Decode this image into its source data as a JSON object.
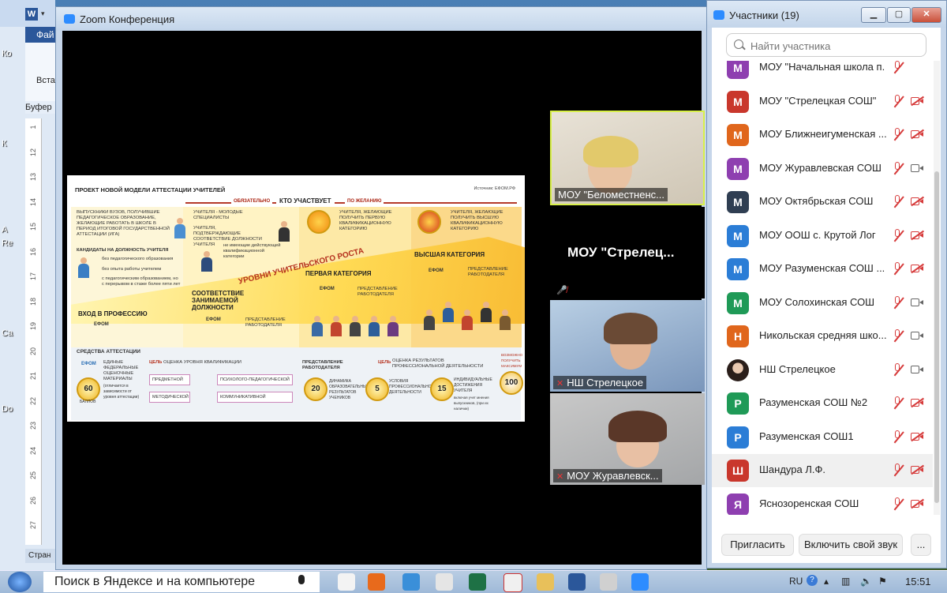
{
  "word": {
    "tab": "Фай",
    "paste": "Вста",
    "buffer": "Буфер",
    "status": "Стран",
    "ruler": [
      "1",
      "12",
      "13",
      "14",
      "15",
      "16",
      "17",
      "18",
      "19",
      "20",
      "21",
      "22",
      "23",
      "24",
      "25",
      "26",
      "27"
    ]
  },
  "desktop_labels": [
    "Ко",
    "К",
    "A",
    "Re",
    "Ca",
    "Do"
  ],
  "zoom": {
    "title": "Zoom Конференция"
  },
  "slide": {
    "header": "ПРОЕКТ НОВОЙ МОДЕЛИ АТТЕСТАЦИИ УЧИТЕЛЕЙ",
    "source": "Источник: ЕФОМ.РФ",
    "obligatory": "ОБЯЗАТЕЛЬНО",
    "who": "КТО УЧАСТВУЕТ",
    "wish": "ПО ЖЕЛАНИЮ",
    "growth": "УРОВНИ УЧИТЕЛЬСКОГО РОСТА",
    "col1_text": "ВЫПУСКНИКИ ВУЗОВ, ПОЛУЧИВШИЕ ПЕДАГОГИЧЕСКОЕ ОБРАЗОВАНИЕ, ЖЕЛАЮЩИЕ РАБОТАТЬ В ШКОЛЕ В ПЕРИОД ИТОГОВОЙ ГОСУДАРСТВЕННОЙ АТТЕСТАЦИИ (ИГА)",
    "col1_cand": "КАНДИДАТЫ НА ДОЛЖНОСТЬ УЧИТЕЛЯ",
    "col1_a": "без педагогического образования",
    "col1_b": "без опыта работы учителем",
    "col1_c": "с педагогическим образованием, но с перерывом в стаже более пяти лет",
    "col2_text": "УЧИТЕЛЯ - МОЛОДЫЕ СПЕЦИАЛИСТЫ",
    "col2_text2": "УЧИТЕЛЯ, ПОДТВЕРЖДАЮЩИЕ СООТВЕТСТВИЕ ДОЛЖНОСТИ УЧИТЕЛЯ",
    "col2_text3": "не имеющие действующей квалификационной категории",
    "col3_text": "УЧИТЕЛЯ, ЖЕЛАЮЩИЕ ПОЛУЧИТЬ ПЕРВУЮ КВАЛИФИКАЦИОННУЮ КАТЕГОРИЮ",
    "col4_text": "УЧИТЕЛЯ, ЖЕЛАЮЩИЕ ПОЛУЧИТЬ ВЫСШУЮ КВАЛИФИКАЦИОННУЮ КАТЕГОРИЮ",
    "lvl1": "ВХОД В ПРОФЕССИЮ",
    "lvl2": "СООТВЕТСТВИЕ ЗАНИМАЕМОЙ ДОЛЖНОСТИ",
    "lvl3": "ПЕРВАЯ КАТЕГОРИЯ",
    "lvl4": "ВЫСШАЯ КАТЕГОРИЯ",
    "efom": "ЕФОМ",
    "employer": "ПРЕДСТАВЛЕНИЕ РАБОТОДАТЕЛЯ",
    "means": "СРЕДСТВА АТТЕСТАЦИИ",
    "efom_full": "ЕДИНЫЕ ФЕДЕРАЛЬНЫЕ ОЦЕНОЧНЫЕ МАТЕРИАЛЫ",
    "efom_note": "(отличается в зависимости от уровня аттестации)",
    "goal": "ЦЕЛЬ",
    "goal1": "ОЦЕНКА УРОВНЯ КВАЛИФИКАЦИИ",
    "goal2": "ОЦЕНКА РЕЗУЛЬТАТОВ ПРОФЕССИОНАЛЬНОЙ ДЕЯТЕЛЬНОСТИ",
    "pills": [
      "ПРЕДМЕТНОЙ",
      "ПСИХОЛОГО-ПЕДАГОГИЧЕСКОЙ",
      "МЕТОДИЧЕСКОЙ",
      "КОММУНИКАТИВНОЙ"
    ],
    "m60": "60",
    "m20": "20",
    "m5": "5",
    "m15": "15",
    "m100": "100",
    "balls": "БАЛЛОВ",
    "d20": "ДИНАМИКА ОБРАЗОВАТЕЛЬНЫХ РЕЗУЛЬТАТОВ УЧЕНИКОВ",
    "d5": "УСЛОВИЯ ПРОФЕССИОНАЛЬНОЙ ДЕЯТЕЛЬНОСТИ",
    "d15": "ИНДИВИДУАЛЬНЫЕ ДОСТИЖЕНИЯ УЧИТЕЛЯ",
    "d15b": "включая учет мнения выпускников, (при их наличии)",
    "max": "ВОЗМОЖНО ПОЛУЧИТЬ МАКСИМУМ"
  },
  "tiles": [
    {
      "label": "МОУ \"Беломестненс...",
      "muted": false
    },
    {
      "center": "МОУ \"Стрелец...",
      "muted": true
    },
    {
      "label": "НШ Стрелецкое",
      "muted": true
    },
    {
      "label": "МОУ Журавлевск...",
      "muted": true
    }
  ],
  "participants": {
    "title": "Участники (19)",
    "search_placeholder": "Найти участника",
    "invite": "Пригласить",
    "unmute": "Включить свой звук",
    "more": "...",
    "list": [
      {
        "initial": "М",
        "name": "МОУ \"Начальная школа п. Ду...",
        "color": "#8e3fb0",
        "cam": "none"
      },
      {
        "initial": "М",
        "name": "МОУ \"Стрелецкая СОШ\"",
        "color": "#c9372c",
        "cam": "off"
      },
      {
        "initial": "М",
        "name": "МОУ Ближнеигуменская ...",
        "color": "#e0661c",
        "cam": "off"
      },
      {
        "initial": "М",
        "name": "МОУ Журавлевская СОШ",
        "color": "#8e3fb0",
        "cam": "on"
      },
      {
        "initial": "М",
        "name": "МОУ Октябрьская СОШ",
        "color": "#2f3e52",
        "cam": "off"
      },
      {
        "initial": "М",
        "name": "МОУ ООШ с. Крутой Лог",
        "color": "#2b7dd6",
        "cam": "off"
      },
      {
        "initial": "М",
        "name": "МОУ Разуменская СОШ ...",
        "color": "#2b7dd6",
        "cam": "off"
      },
      {
        "initial": "М",
        "name": "МОУ Солохинская СОШ",
        "color": "#1f9a57",
        "cam": "on"
      },
      {
        "initial": "Н",
        "name": "Никольская средняя шко...",
        "color": "#e0661c",
        "cam": "on"
      },
      {
        "initial": "",
        "name": "НШ Стрелецкое",
        "color": "#6b5a55",
        "cam": "on"
      },
      {
        "initial": "Р",
        "name": "Разуменская СОШ №2",
        "color": "#1f9a57",
        "cam": "off"
      },
      {
        "initial": "Р",
        "name": "Разуменская СОШ1",
        "color": "#2b7dd6",
        "cam": "off"
      },
      {
        "initial": "Ш",
        "name": "Шандура Л.Ф.",
        "color": "#c9372c",
        "cam": "off"
      },
      {
        "initial": "Я",
        "name": "Яснозоренская СОШ",
        "color": "#8e3fb0",
        "cam": "off"
      }
    ]
  },
  "taskbar": {
    "search": "Поиск в Яндексе и на компьютере",
    "lang": "RU",
    "time": "15:51"
  },
  "colors": {
    "accent": "#2d8cff",
    "muted": "#d63b3b"
  }
}
